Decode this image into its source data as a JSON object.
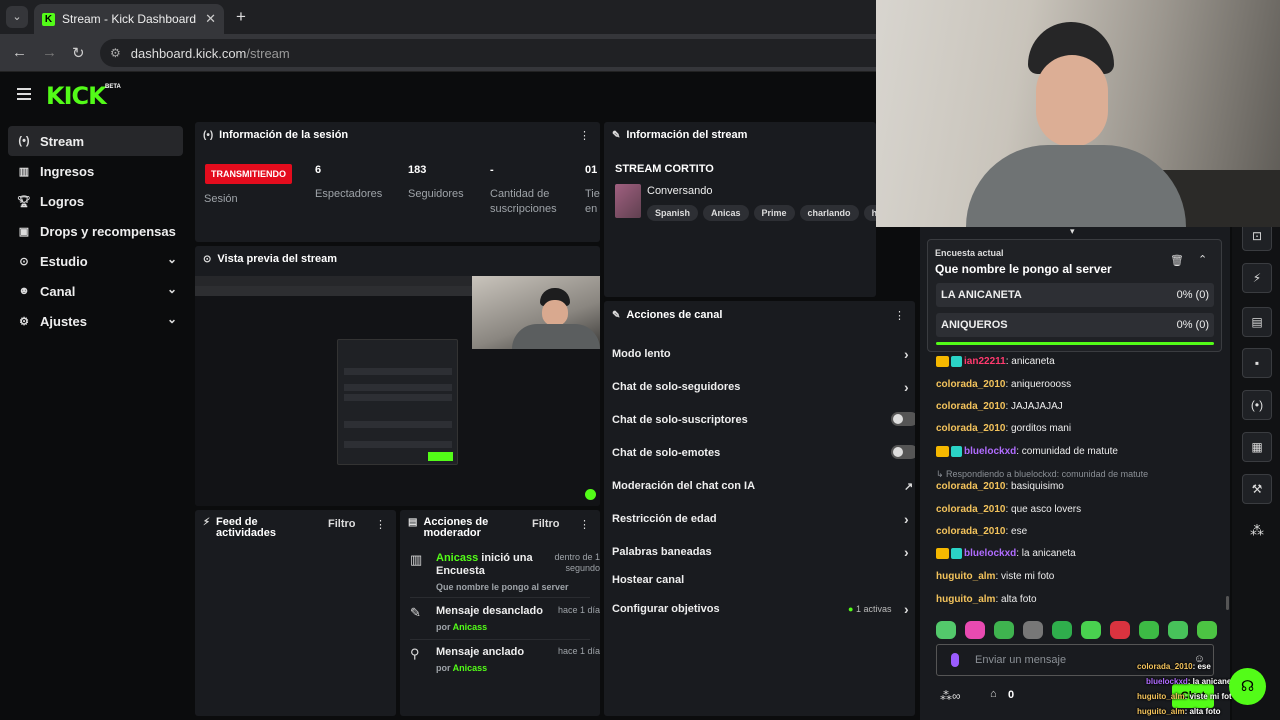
{
  "browser": {
    "tab_title": "Stream - Kick Dashboard",
    "url_host": "dashboard.kick.com",
    "url_path": "/stream"
  },
  "brand": {
    "logo": "KICK",
    "beta": "BETA",
    "accent": "#53fc18"
  },
  "sidebar": {
    "items": [
      {
        "label": "Stream",
        "icon": "radio-icon",
        "active": true
      },
      {
        "label": "Ingresos",
        "icon": "chart-icon"
      },
      {
        "label": "Logros",
        "icon": "trophy-icon"
      },
      {
        "label": "Drops y recompensas",
        "icon": "gift-icon"
      },
      {
        "label": "Estudio",
        "icon": "studio-icon",
        "expandable": true
      },
      {
        "label": "Canal",
        "icon": "users-icon",
        "expandable": true
      },
      {
        "label": "Ajustes",
        "icon": "gear-icon",
        "expandable": true
      }
    ]
  },
  "session": {
    "title": "Información de la sesión",
    "status": "TRANSMITIENDO",
    "session_label": "Sesión",
    "stats": [
      {
        "value": "6",
        "label": "Espectadores"
      },
      {
        "value": "183",
        "label": "Seguidores"
      },
      {
        "value": "-",
        "label": "Cantidad de suscripciones"
      },
      {
        "value": "01",
        "label": "Tie en"
      }
    ]
  },
  "stream_info": {
    "title": "Información del stream",
    "stream_title": "STREAM CORTITO",
    "category": "Conversando",
    "tags": [
      "Spanish",
      "Anicas",
      "Prime",
      "charlando",
      "haxb"
    ]
  },
  "preview": {
    "title": "Vista previa del stream"
  },
  "channel_actions": {
    "title": "Acciones de canal",
    "items": [
      {
        "label": "Modo lento",
        "control": "chevron"
      },
      {
        "label": "Chat de solo-seguidores",
        "control": "chevron"
      },
      {
        "label": "Chat de solo-suscriptores",
        "control": "toggle"
      },
      {
        "label": "Chat de solo-emotes",
        "control": "toggle"
      },
      {
        "label": "Moderación del chat con IA",
        "control": "external"
      },
      {
        "label": "Restricción de edad",
        "control": "chevron"
      },
      {
        "label": "Palabras baneadas",
        "control": "chevron"
      },
      {
        "label": "Hostear canal",
        "control": "none"
      },
      {
        "label": "Configurar objetivos",
        "control": "chevron",
        "extra": "1 activas"
      }
    ]
  },
  "activity_feed": {
    "title": "Feed de actividades",
    "filter": "Filtro"
  },
  "mod_actions": {
    "title": "Acciones de moderador",
    "filter": "Filtro",
    "items": [
      {
        "actor": "Anicass",
        "action": " inició una Encuesta",
        "time": "dentro de 1 segundo",
        "detail": "Que nombre le pongo al server"
      },
      {
        "action": "Mensaje desanclado",
        "time": "hace 1 día",
        "by_prefix": "por ",
        "by": "Anicass"
      },
      {
        "action": "Mensaje anclado",
        "time": "hace 1 día",
        "by_prefix": "por ",
        "by": "Anicass"
      }
    ]
  },
  "poll": {
    "header": "Encuesta actual",
    "question": "Que nombre le pongo al server",
    "options": [
      {
        "label": "LA ANICANETA",
        "result": "0% (0)"
      },
      {
        "label": "ANIQUEROS",
        "result": "0% (0)"
      }
    ],
    "progress": 1.0
  },
  "chat": {
    "messages": [
      {
        "user": "ian22211",
        "text": ": anicaneta",
        "color": "#ff3a6e",
        "badges": true
      },
      {
        "user": "colorada_2010",
        "text": ": aniqueroooss",
        "color": "#f3c35c"
      },
      {
        "user": "colorada_2010",
        "text": ": JAJAJAJAJ",
        "color": "#f3c35c"
      },
      {
        "user": "colorada_2010",
        "text": ": gorditos mani",
        "color": "#f3c35c"
      },
      {
        "user": "bluelockxd",
        "text": ": comunidad de matute",
        "color": "#b06cff",
        "badges": true
      },
      {
        "user": "colorada_2010",
        "text": ": basiquisimo",
        "color": "#f3c35c"
      },
      {
        "user": "colorada_2010",
        "text": ": que asco lovers",
        "color": "#f3c35c"
      },
      {
        "user": "colorada_2010",
        "text": ": ese",
        "color": "#f3c35c"
      },
      {
        "user": "bluelockxd",
        "text": ": la anicaneta",
        "color": "#b06cff",
        "badges": true
      },
      {
        "user": "huguito_alm",
        "text": ": viste mi foto",
        "color": "#f3c35c"
      },
      {
        "user": "huguito_alm",
        "text": ": alta foto",
        "color": "#f3c35c"
      }
    ],
    "reply_note": "Respondiendo a bluelockxd: comunidad de matute",
    "input_placeholder": "Enviar un mensaje",
    "points": "0",
    "send_label": "Chat"
  },
  "overlay_chat": [
    {
      "user": "colorada_2010",
      "text": ": ese"
    },
    {
      "user": "bluelockxd",
      "text": ": la anicaneta"
    },
    {
      "user": "huguito_alm",
      "text": ": viste mi foto"
    },
    {
      "user": "huguito_alm",
      "text": ": alta foto"
    }
  ]
}
